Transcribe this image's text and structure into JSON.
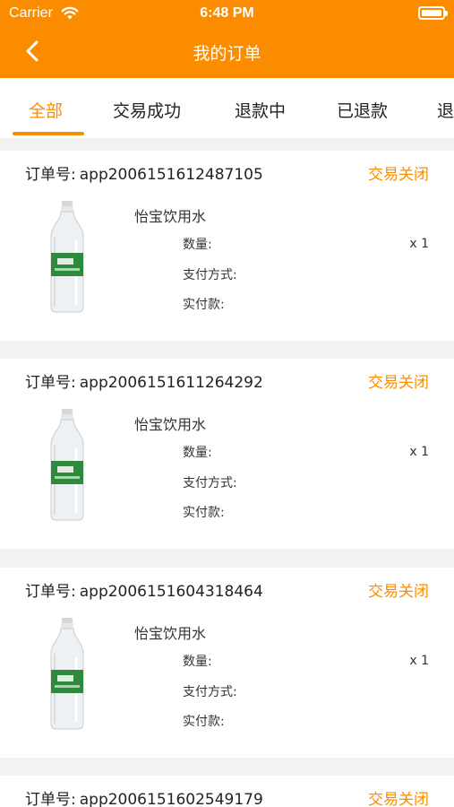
{
  "status_bar": {
    "carrier": "Carrier",
    "time": "6:48 PM"
  },
  "nav": {
    "title": "我的订单",
    "back_icon": "chevron-left-icon"
  },
  "tabs": [
    {
      "label": "全部",
      "active": true
    },
    {
      "label": "交易成功",
      "active": false
    },
    {
      "label": "退款中",
      "active": false
    },
    {
      "label": "已退款",
      "active": false
    },
    {
      "label": "退",
      "active": false
    }
  ],
  "labels": {
    "order_no": "订单号:",
    "quantity": "数量:",
    "payment_method": "支付方式:",
    "paid": "实付款:"
  },
  "orders": [
    {
      "order_no": "app2006151612487105",
      "status": "交易关闭",
      "product": "怡宝饮用水",
      "quantity": "x 1"
    },
    {
      "order_no": "app2006151611264292",
      "status": "交易关闭",
      "product": "怡宝饮用水",
      "quantity": "x 1"
    },
    {
      "order_no": "app2006151604318464",
      "status": "交易关闭",
      "product": "怡宝饮用水",
      "quantity": "x 1"
    },
    {
      "order_no": "app2006151602549179",
      "status": "交易关闭"
    }
  ],
  "colors": {
    "accent": "#fb8c00",
    "background": "#f2f2f2"
  }
}
